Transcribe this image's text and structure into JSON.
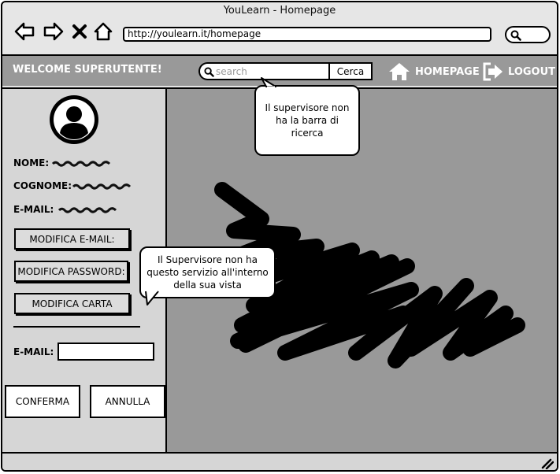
{
  "window": {
    "title": "YouLearn - Homepage"
  },
  "browser": {
    "url": "http://youlearn.it/homepage",
    "nav_icons": [
      "arrow-left-icon",
      "arrow-right-icon",
      "close-icon",
      "home-icon"
    ],
    "search_icon": "search-icon"
  },
  "appbar": {
    "welcome": "WELCOME SUPERUTENTE!",
    "search_placeholder": "search",
    "search_button": "Cerca",
    "homepage_label": "HOMEPAGE",
    "logout_label": "LOGOUT",
    "bg_color": "#999999",
    "text_color": "#ffffff"
  },
  "sidebar": {
    "avatar_icon": "user-avatar-icon",
    "nome_label": "NOME:",
    "cognome_label": "COGNOME:",
    "email_label": "E-MAIL:",
    "btn_modifica_email": "MODIFICA E-MAIL:",
    "btn_modifica_password": "MODIFICA PASSWORD:",
    "btn_modifica_carta": "MODIFICA CARTA",
    "email_field_label": "E-MAIL:",
    "email_value": "",
    "btn_conferma": "CONFERMA",
    "btn_annulla": "ANNULLA"
  },
  "notes": {
    "search_note": "Il supervisore non ha la barra di ricerca",
    "service_note": "Il Supervisore non ha questo servizio all'interno della sua vista"
  }
}
